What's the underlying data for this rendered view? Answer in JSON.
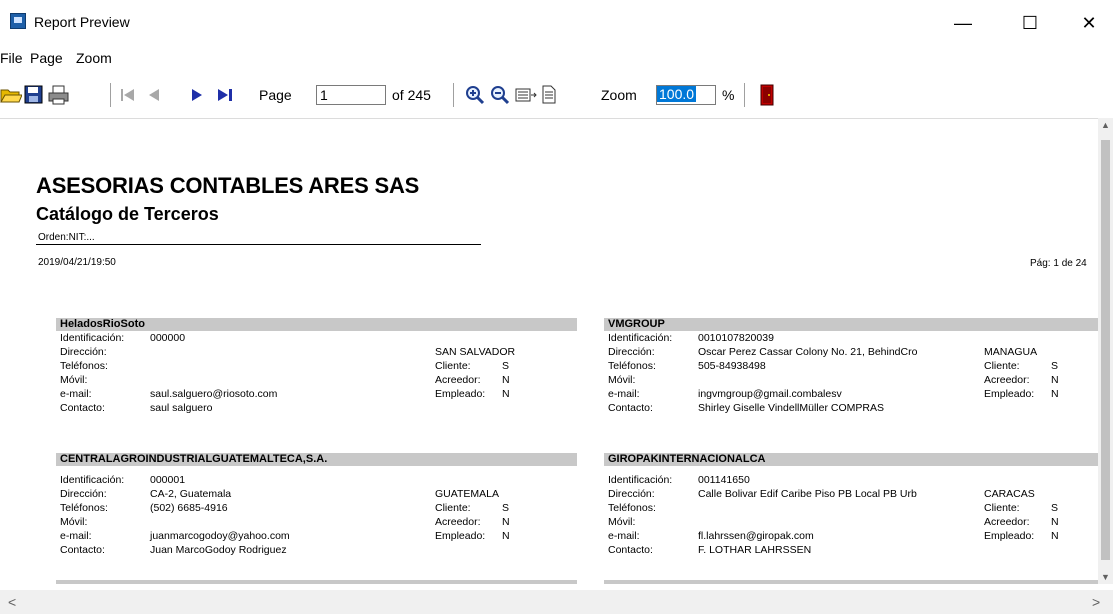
{
  "window": {
    "title": "Report Preview",
    "minimize": "—",
    "maximize": "☐",
    "close": "✕"
  },
  "menu": {
    "file": "File",
    "page": "Page",
    "zoom": "Zoom"
  },
  "toolbar": {
    "page_label": "Page",
    "page_value": "1",
    "page_total": "of 245",
    "zoom_label": "Zoom",
    "zoom_value": "100.0",
    "zoom_unit": "%"
  },
  "report": {
    "company": "ASESORIAS CONTABLES ARES SAS",
    "title": "Catálogo de Terceros",
    "order": "Orden:NIT:...",
    "timestamp": "2019/04/21/19:50",
    "page_indicator": "Pág: 1 de 24"
  },
  "labels": {
    "id": "Identificación:",
    "address": "Dirección:",
    "phones": "Teléfonos:",
    "mobile": "Móvil:",
    "email": "e-mail:",
    "contact": "Contacto:",
    "client": "Cliente:",
    "creditor": "Acreedor:",
    "employee": "Empleado:"
  },
  "records": [
    {
      "name": "HeladosRioSoto",
      "id": "000000",
      "address": "",
      "city": "SAN SALVADOR",
      "phones": "",
      "email": "saul.salguero@riosoto.com",
      "contact": "saul salguero",
      "client": "S",
      "creditor": "N",
      "employee": "N"
    },
    {
      "name": "VMGROUP",
      "id": "0010107820039",
      "address": "Oscar Perez Cassar Colony No. 21, BehindCro",
      "city": "MANAGUA",
      "phones": "505-84938498",
      "email": "ingvmgroup@gmail.combalesv",
      "contact": "Shirley Giselle VindellMüller COMPRAS",
      "client": "S",
      "creditor": "N",
      "employee": "N"
    },
    {
      "name": "CENTRALAGROINDUSTRIALGUATEMALTECA,S.A.",
      "id": "000001",
      "address": "CA-2, Guatemala",
      "city": "GUATEMALA",
      "phones": "(502) 6685-4916",
      "email": "juanmarcogodoy@yahoo.com",
      "contact": "Juan MarcoGodoy Rodriguez",
      "client": "S",
      "creditor": "N",
      "employee": "N"
    },
    {
      "name": "GIROPAKINTERNACIONALCA",
      "id": "001141650",
      "address": "Calle Bolivar Edif Caribe Piso PB Local PB Urb",
      "city": "CARACAS",
      "phones": "",
      "email": "fl.lahrssen@giropak.com",
      "contact": "F. LOTHAR LAHRSSEN",
      "client": "S",
      "creditor": "N",
      "employee": "N"
    }
  ]
}
